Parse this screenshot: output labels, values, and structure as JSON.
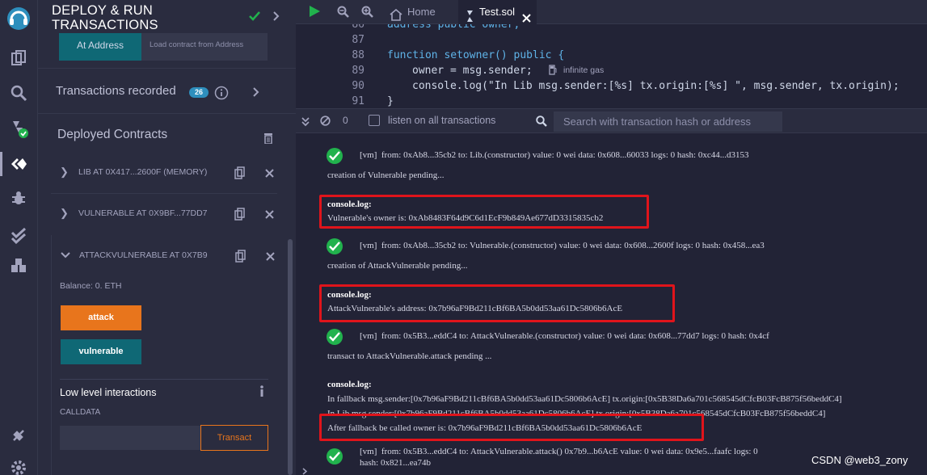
{
  "side_panel": {
    "title_line1": "DEPLOY & RUN",
    "title_line2": "TRANSACTIONS",
    "at_address_button": "At Address",
    "load_contract_placeholder": "Load contract from Address",
    "transactions_recorded": "Transactions recorded",
    "transactions_count": "26",
    "deployed_contracts": "Deployed Contracts",
    "instances": [
      {
        "label": "LIB AT 0X417...2600F (MEMORY)"
      },
      {
        "label": "VULNERABLE AT 0X9BF...77DD7"
      },
      {
        "label": "ATTACKVULNERABLE AT 0X7B9"
      }
    ],
    "balance": "Balance: 0. ETH",
    "attack_button": "attack",
    "vulnerable_button": "vulnerable",
    "low_level_title": "Low level interactions",
    "calldata_label": "CALLDATA",
    "transact_button": "Transact"
  },
  "tabs": {
    "home": "Home",
    "active": "Test.sol"
  },
  "editor": {
    "lines": [
      {
        "no": "86",
        "text": "address public owner;"
      },
      {
        "no": "87",
        "text": ""
      },
      {
        "no": "88",
        "text": "function setowner() public {"
      },
      {
        "no": "89",
        "text": "owner = msg.sender;"
      },
      {
        "no": "90",
        "text": "console.log(\"In Lib msg.sender:[%s] tx.origin:[%s] \", msg.sender, tx.origin);"
      },
      {
        "no": "91",
        "text": "}"
      }
    ],
    "gas_hint": "infinite gas"
  },
  "terminal_bar": {
    "pending_count": "0",
    "listen_label": "listen on all transactions",
    "search_placeholder": "Search with transaction hash or address"
  },
  "terminal": {
    "tx1": "[vm]  from: 0xAb8...35cb2 to: Lib.(constructor) value: 0 wei data: 0x608...60033 logs: 0 hash: 0xc44...d3153",
    "pending1": "creation of Vulnerable pending...",
    "log1_title": "console.log:",
    "log1_text": "Vulnerable's owner is: 0xAb8483F64d9C6d1EcF9b849Ae677dD3315835cb2",
    "tx2": "[vm]  from: 0xAb8...35cb2 to: Vulnerable.(constructor) value: 0 wei data: 0x608...2600f logs: 0 hash: 0x458...ea3",
    "pending2": "creation of AttackVulnerable pending...",
    "log2_title": "console.log:",
    "log2_text": "AttackVulnerable's address: 0x7b96aF9Bd211cBf6BA5b0dd53aa61Dc5806b6AcE",
    "tx3": "[vm]  from: 0x5B3...eddC4 to: AttackVulnerable.(constructor) value: 0 wei data: 0x608...77dd7 logs: 0 hash: 0x4cf",
    "pending3": "transact to AttackVulnerable.attack pending ...",
    "log3_title": "console.log:",
    "log3_line1": "In fallback msg.sender:[0x7b96aF9Bd211cBf6BA5b0dd53aa61Dc5806b6AcE] tx.origin:[0x5B38Da6a701c568545dCfcB03FcB875f56beddC4]",
    "log3_line2": "In Lib msg.sender:[0x7b96aF9Bd211cBf6BA5b0dd53aa61Dc5806b6AcE] tx.origin:[0x5B38Da6a701c568545dCfcB03FcB875f56beddC4]",
    "log3_line3": "After fallback be called owner is: 0x7b96aF9Bd211cBf6BA5b0dd53aa61Dc5806b6AcE",
    "tx4": "[vm]  from: 0x5B3...eddC4 to: AttackVulnerable.attack() 0x7b9...b6AcE value: 0 wei data: 0x9e5...faafc logs: 0",
    "tx4_cont": "hash: 0x821...ea74b"
  },
  "watermark": "CSDN @web3_zony",
  "colors": {
    "accent_orange": "#e8751c",
    "teal": "#0f6875",
    "success_green": "#21b24d",
    "highlight_red": "#e0141b"
  }
}
